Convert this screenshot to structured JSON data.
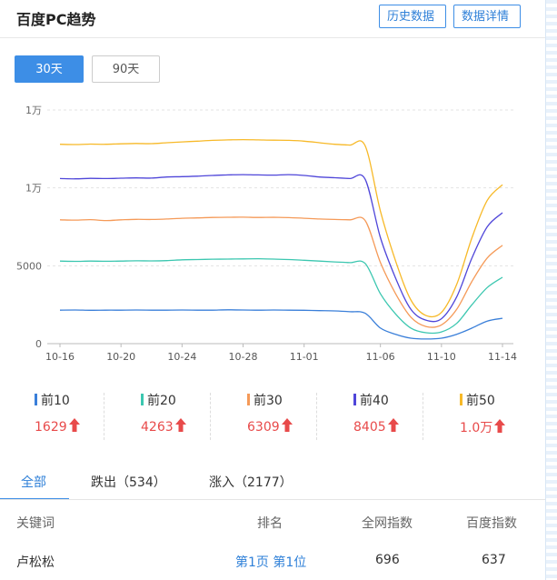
{
  "header": {
    "title": "百度PC趋势",
    "history_btn": "历史数据",
    "detail_btn": "数据详情"
  },
  "range": {
    "active": "30天",
    "other": "90天"
  },
  "chart_data": {
    "type": "line",
    "y_ticks": [
      {
        "value": 0,
        "label": "0"
      },
      {
        "value": 5000,
        "label": "5000"
      },
      {
        "value": 10000,
        "label": "1万"
      },
      {
        "value": 15000,
        "label": "1万"
      }
    ],
    "ylim": [
      0,
      15000
    ],
    "x_ticks": [
      "10-16",
      "10-20",
      "10-24",
      "10-28",
      "11-01",
      "11-06",
      "11-10",
      "11-14"
    ],
    "x": [
      "10-16",
      "10-17",
      "10-18",
      "10-19",
      "10-20",
      "10-21",
      "10-22",
      "10-23",
      "10-24",
      "10-25",
      "10-26",
      "10-27",
      "10-28",
      "10-29",
      "10-30",
      "10-31",
      "11-01",
      "11-02",
      "11-03",
      "11-04",
      "11-05",
      "11-06",
      "11-07",
      "11-08",
      "11-09",
      "11-10",
      "11-11",
      "11-12",
      "11-13",
      "11-14"
    ],
    "series": [
      {
        "name": "前10",
        "color": "#3a7fd9",
        "values": [
          2150,
          2160,
          2140,
          2150,
          2150,
          2160,
          2150,
          2150,
          2160,
          2150,
          2150,
          2170,
          2160,
          2150,
          2160,
          2150,
          2140,
          2120,
          2100,
          2050,
          1950,
          1000,
          600,
          350,
          300,
          350,
          600,
          1000,
          1450,
          1629
        ]
      },
      {
        "name": "前20",
        "color": "#3cc7b0",
        "values": [
          5300,
          5280,
          5300,
          5290,
          5300,
          5320,
          5310,
          5330,
          5380,
          5400,
          5420,
          5430,
          5440,
          5450,
          5430,
          5400,
          5350,
          5300,
          5250,
          5200,
          5150,
          3200,
          1900,
          1000,
          700,
          750,
          1300,
          2500,
          3600,
          4263
        ]
      },
      {
        "name": "前30",
        "color": "#f59a58",
        "values": [
          7950,
          7930,
          7960,
          7900,
          7950,
          7980,
          7970,
          8000,
          8050,
          8070,
          8100,
          8110,
          8120,
          8100,
          8110,
          8090,
          8050,
          8000,
          7970,
          7950,
          7900,
          5200,
          3200,
          1700,
          1100,
          1200,
          2200,
          4000,
          5500,
          6309
        ]
      },
      {
        "name": "前40",
        "color": "#4f46d9",
        "values": [
          10600,
          10580,
          10610,
          10600,
          10620,
          10640,
          10630,
          10700,
          10720,
          10750,
          10800,
          10830,
          10850,
          10830,
          10820,
          10850,
          10800,
          10700,
          10650,
          10600,
          10550,
          6800,
          4200,
          2200,
          1500,
          1600,
          3000,
          5500,
          7500,
          8405
        ]
      },
      {
        "name": "前50",
        "color": "#f7b928",
        "values": [
          12800,
          12780,
          12810,
          12800,
          12830,
          12850,
          12840,
          12900,
          12950,
          13000,
          13050,
          13080,
          13100,
          13080,
          13060,
          13050,
          13000,
          12900,
          12800,
          12750,
          12700,
          8500,
          5300,
          2800,
          1800,
          2000,
          3800,
          6800,
          9200,
          10200
        ]
      }
    ]
  },
  "legend": [
    {
      "name": "前10",
      "value": "1629",
      "color": "#3a7fd9"
    },
    {
      "name": "前20",
      "value": "4263",
      "color": "#3cc7b0"
    },
    {
      "name": "前30",
      "value": "6309",
      "color": "#f59a58"
    },
    {
      "name": "前40",
      "value": "8405",
      "color": "#4f46d9"
    },
    {
      "name": "前50",
      "value": "1.0万",
      "color": "#f7b928"
    }
  ],
  "tabs": {
    "all": "全部",
    "down": "跌出（534）",
    "up": "涨入（2177）"
  },
  "table": {
    "headers": [
      "关键词",
      "排名",
      "全网指数",
      "百度指数"
    ],
    "rows": [
      {
        "keyword": "卢松松",
        "rank": "第1页 第1位",
        "all_index": "696",
        "baidu_index": "637"
      }
    ]
  }
}
